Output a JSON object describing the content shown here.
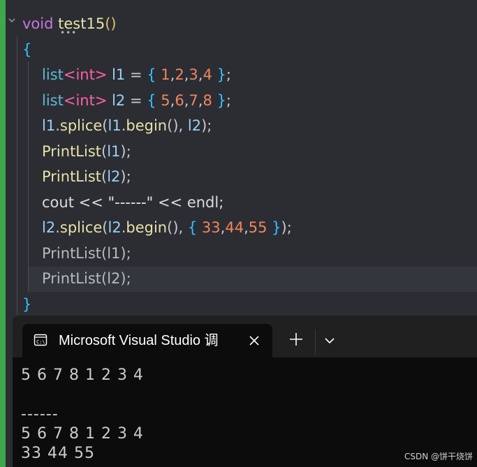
{
  "editor": {
    "lines": [
      {
        "tokens": [
          [
            "tok-kw",
            "void "
          ],
          [
            "tok-fn-name",
            "test15"
          ],
          [
            "tok-paren",
            "()"
          ]
        ]
      },
      {
        "tokens": [
          [
            "tok-brace",
            "{"
          ]
        ]
      },
      {
        "tokens": [
          [
            "tok-type",
            "list"
          ],
          [
            "tok-tmpl",
            "<int>"
          ],
          [
            "tok-var",
            " l1 "
          ],
          [
            "tok-punc",
            "= "
          ],
          [
            "tok-brace",
            "{ "
          ],
          [
            "tok-num",
            "1"
          ],
          [
            "tok-punc",
            ","
          ],
          [
            "tok-num",
            "2"
          ],
          [
            "tok-punc",
            ","
          ],
          [
            "tok-num",
            "3"
          ],
          [
            "tok-punc",
            ","
          ],
          [
            "tok-num",
            "4"
          ],
          [
            "tok-brace",
            " }"
          ],
          [
            "tok-punc",
            ";"
          ]
        ]
      },
      {
        "tokens": [
          [
            "tok-type",
            "list"
          ],
          [
            "tok-tmpl",
            "<int>"
          ],
          [
            "tok-var",
            " l2 "
          ],
          [
            "tok-punc",
            "= "
          ],
          [
            "tok-brace",
            "{ "
          ],
          [
            "tok-num",
            "5"
          ],
          [
            "tok-punc",
            ","
          ],
          [
            "tok-num",
            "6"
          ],
          [
            "tok-punc",
            ","
          ],
          [
            "tok-num",
            "7"
          ],
          [
            "tok-punc",
            ","
          ],
          [
            "tok-num",
            "8"
          ],
          [
            "tok-brace",
            " }"
          ],
          [
            "tok-punc",
            ";"
          ]
        ]
      },
      {
        "tokens": [
          [
            "tok-var",
            "l1"
          ],
          [
            "tok-punc",
            "."
          ],
          [
            "tok-fn",
            "splice"
          ],
          [
            "tok-punc",
            "("
          ],
          [
            "tok-var",
            "l1"
          ],
          [
            "tok-punc",
            "."
          ],
          [
            "tok-fn",
            "begin"
          ],
          [
            "tok-punc",
            "(), "
          ],
          [
            "tok-var",
            "l2"
          ],
          [
            "tok-punc",
            ");"
          ]
        ]
      },
      {
        "tokens": [
          [
            "tok-fn",
            "PrintList"
          ],
          [
            "tok-punc",
            "("
          ],
          [
            "tok-var",
            "l1"
          ],
          [
            "tok-punc",
            ");"
          ]
        ]
      },
      {
        "tokens": [
          [
            "tok-fn",
            "PrintList"
          ],
          [
            "tok-punc",
            "("
          ],
          [
            "tok-var",
            "l2"
          ],
          [
            "tok-punc",
            ");"
          ]
        ]
      },
      {
        "tokens": [
          [
            "tok-plain",
            "cout << "
          ],
          [
            "tok-str",
            "\"------\""
          ],
          [
            "tok-plain",
            " << endl;"
          ]
        ]
      },
      {
        "tokens": [
          [
            "tok-var",
            "l2"
          ],
          [
            "tok-punc",
            "."
          ],
          [
            "tok-fn",
            "splice"
          ],
          [
            "tok-punc",
            "("
          ],
          [
            "tok-var",
            "l2"
          ],
          [
            "tok-punc",
            "."
          ],
          [
            "tok-fn",
            "begin"
          ],
          [
            "tok-punc",
            "(), "
          ],
          [
            "tok-brace",
            "{ "
          ],
          [
            "tok-num",
            "33"
          ],
          [
            "tok-punc",
            ","
          ],
          [
            "tok-num",
            "44"
          ],
          [
            "tok-punc",
            ","
          ],
          [
            "tok-num",
            "55"
          ],
          [
            "tok-brace",
            " }"
          ],
          [
            "tok-punc",
            ");"
          ]
        ]
      },
      {
        "tokens": [
          [
            "tok-fn",
            "PrintList"
          ],
          [
            "tok-punc",
            "("
          ],
          [
            "tok-var",
            "l1"
          ],
          [
            "tok-punc",
            ");"
          ]
        ],
        "dim": true
      },
      {
        "tokens": [
          [
            "tok-fn",
            "PrintList"
          ],
          [
            "tok-punc",
            "("
          ],
          [
            "tok-var",
            "l2"
          ],
          [
            "tok-punc",
            ");"
          ]
        ],
        "dim": true
      },
      {
        "tokens": [
          [
            "tok-brace",
            "}"
          ]
        ]
      }
    ],
    "fold_dots": "•••"
  },
  "terminal": {
    "tab_title": "Microsoft Visual Studio 调",
    "tab_icon": "console-icon",
    "close_icon": "close-icon",
    "new_tab_icon": "plus-icon",
    "dropdown_icon": "chevron-down-icon",
    "output": [
      "5 6 7 8 1 2 3 4",
      "",
      "------",
      "5 6 7 8 1 2 3 4",
      "33 44 55"
    ]
  },
  "watermark": "CSDN @饼干烧饼",
  "colors": {
    "editor_bg": "#2b2d33",
    "gutter_accent": "#3fa84c",
    "terminal_bg": "#0c0c0c",
    "tabbar_bg": "#202020"
  }
}
